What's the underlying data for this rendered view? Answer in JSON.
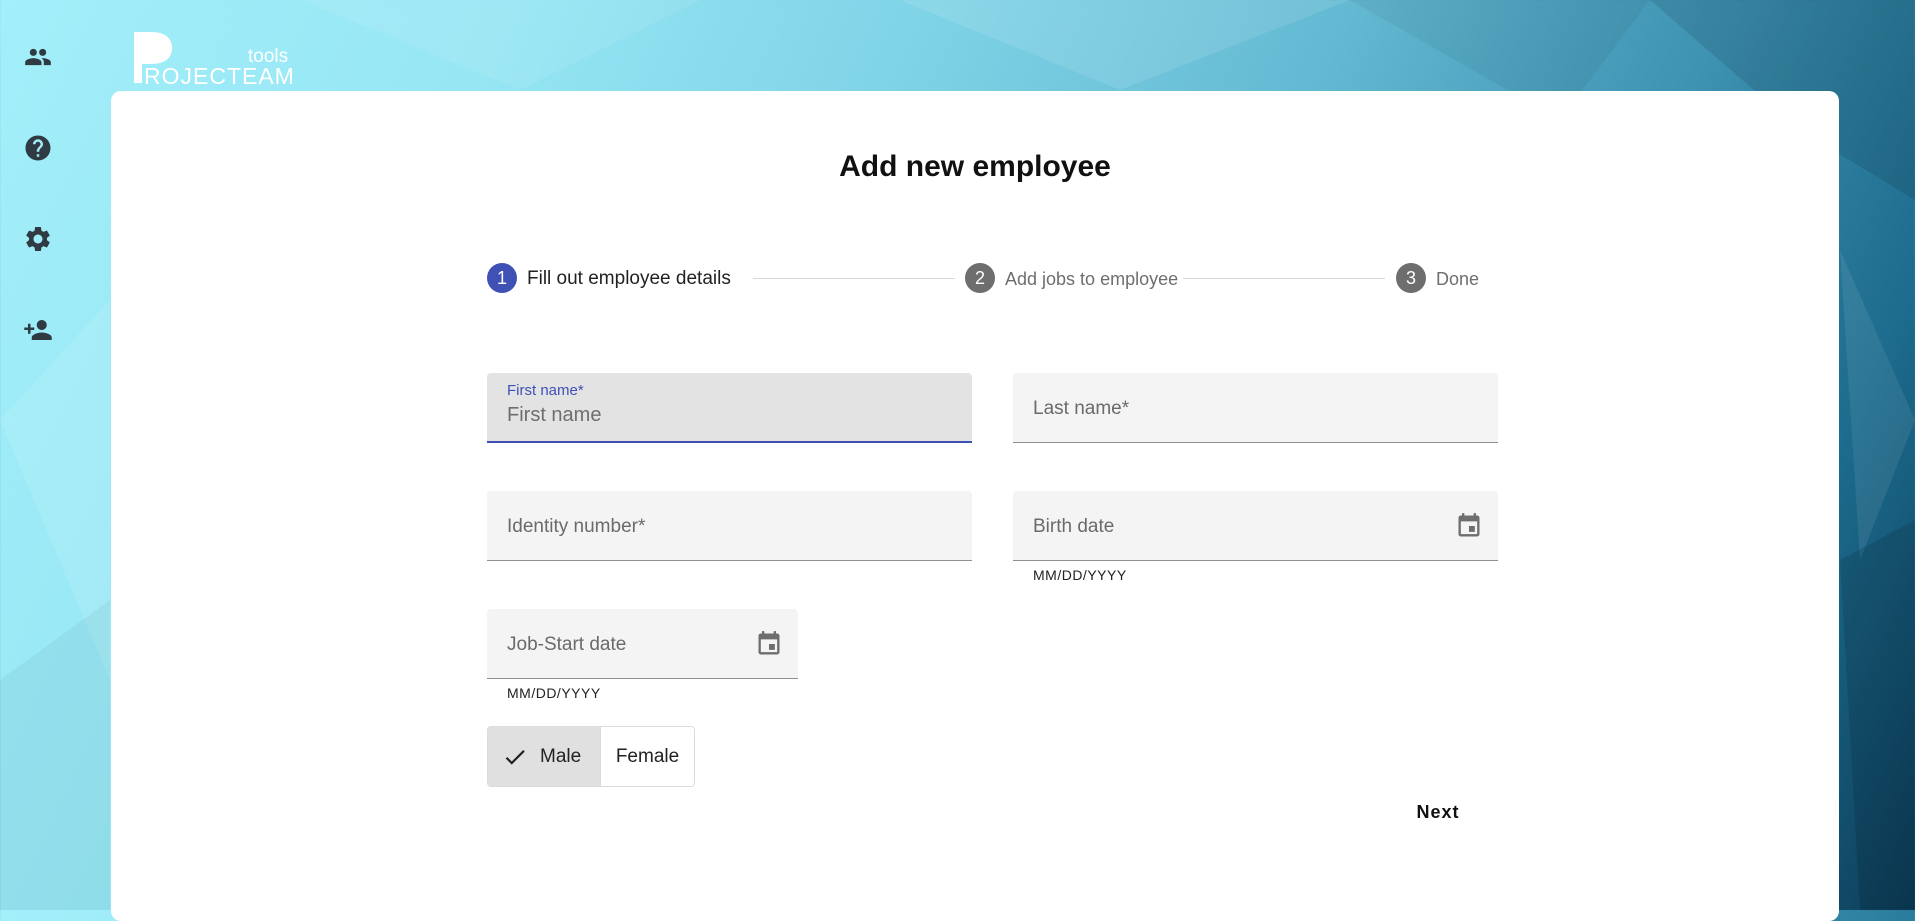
{
  "brand": {
    "logo_main": "ROJECTEAM",
    "logo_sub": "tools"
  },
  "sidebar": {
    "items": [
      {
        "icon": "people-icon",
        "tooltip": "Employees"
      },
      {
        "icon": "help-icon",
        "tooltip": "Help"
      },
      {
        "icon": "gear-icon",
        "tooltip": "Settings"
      },
      {
        "icon": "add-person-icon",
        "tooltip": "Add employee"
      }
    ]
  },
  "page": {
    "title": "Add new employee"
  },
  "stepper": {
    "steps": [
      {
        "number": "1",
        "label": "Fill out employee details",
        "active": true
      },
      {
        "number": "2",
        "label": "Add jobs to employee",
        "active": false
      },
      {
        "number": "3",
        "label": "Done",
        "active": false
      }
    ]
  },
  "form": {
    "first_name": {
      "floating_label": "First name*",
      "placeholder": "First name",
      "value": ""
    },
    "last_name": {
      "label": "Last name*"
    },
    "identity_number": {
      "label": "Identity number*"
    },
    "birth_date": {
      "label": "Birth date",
      "hint": "MM/DD/YYYY"
    },
    "job_start_date": {
      "label": "Job-Start date",
      "hint": "MM/DD/YYYY"
    },
    "gender": {
      "options": [
        "Male",
        "Female"
      ],
      "selected": "Male"
    }
  },
  "actions": {
    "next_label": "Next"
  },
  "colors": {
    "accent": "#3f51b5",
    "inactive_step": "#6e6e6e",
    "field_bg": "#f4f4f4"
  }
}
